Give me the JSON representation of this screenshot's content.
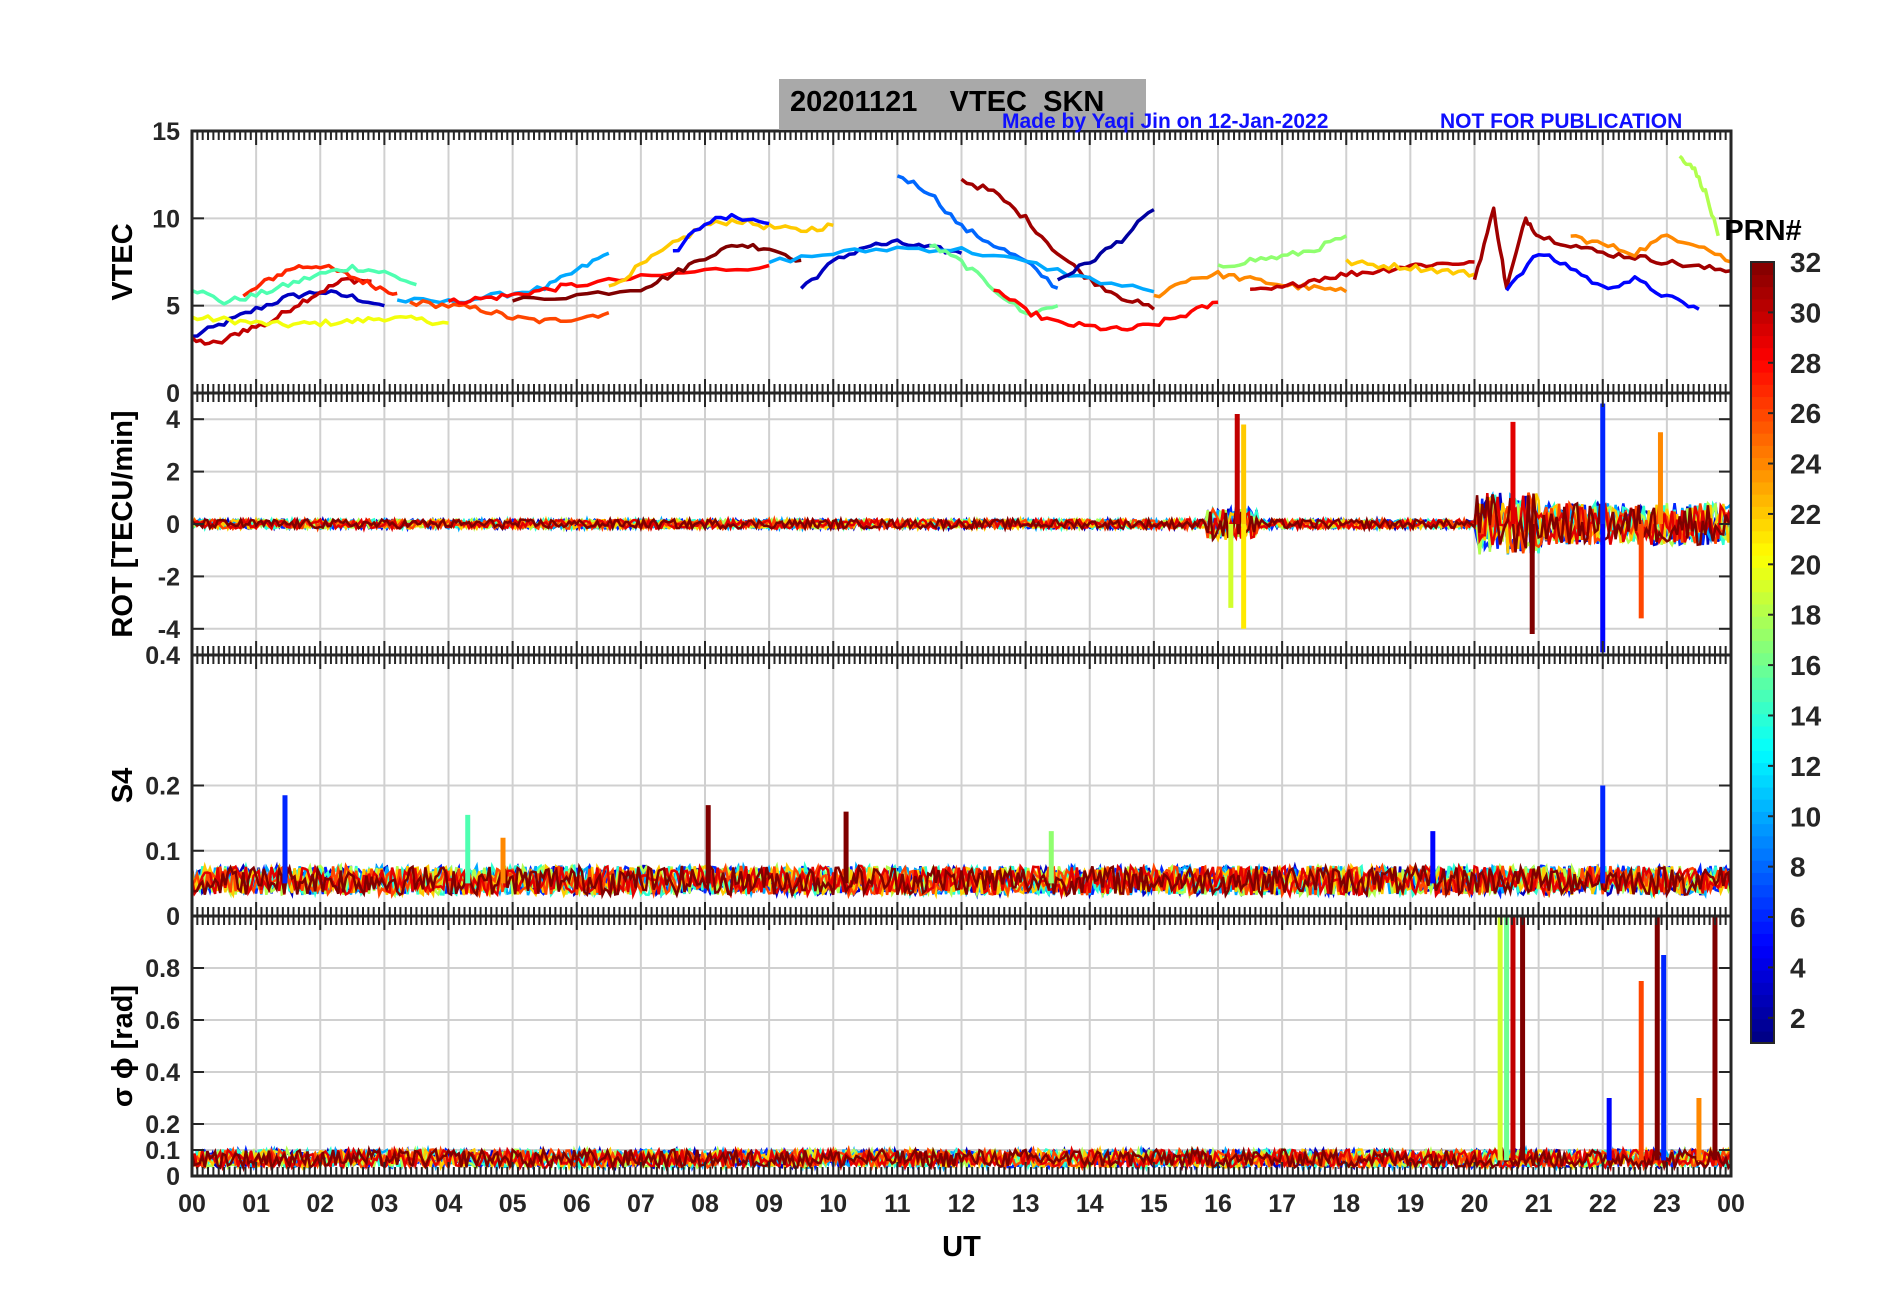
{
  "header": {
    "title": "20201121    VTEC  SKN",
    "credit": "Made by Yaqi Jin on 12-Jan-2022",
    "notice": "NOT FOR PUBLICATION"
  },
  "colorbar": {
    "title": "PRN#",
    "ticks": [
      "2",
      "4",
      "6",
      "8",
      "10",
      "12",
      "14",
      "16",
      "18",
      "20",
      "22",
      "24",
      "26",
      "28",
      "30",
      "32"
    ],
    "range": [
      1,
      32
    ],
    "colormap": "jet"
  },
  "chart_data": [
    {
      "type": "line",
      "panel": "VTEC",
      "ylabel": "VTEC",
      "ylim": [
        0,
        15
      ],
      "yticks": [
        "0",
        "5",
        "10",
        "15"
      ],
      "xlim": [
        0,
        24
      ],
      "grid": true,
      "series": [
        {
          "prn": 3,
          "x": [
            0,
            0.5,
            1.0,
            1.5,
            2.0,
            2.5,
            3.0
          ],
          "y": [
            3.2,
            4.0,
            4.8,
            5.5,
            5.8,
            5.5,
            5.0
          ]
        },
        {
          "prn": 30,
          "x": [
            0,
            0.4,
            0.8,
            1.2,
            1.6,
            2.0,
            2.4,
            2.8
          ],
          "y": [
            3.0,
            2.8,
            3.6,
            4.0,
            5.0,
            5.8,
            6.5,
            6.4
          ]
        },
        {
          "prn": 20,
          "x": [
            0,
            0.5,
            1.0,
            1.5,
            2.0,
            2.5,
            3.0,
            3.5,
            4.0
          ],
          "y": [
            4.3,
            4.2,
            4.0,
            3.9,
            4.0,
            4.1,
            4.3,
            4.2,
            4.0
          ]
        },
        {
          "prn": 27,
          "x": [
            0.8,
            1.2,
            1.6,
            2.0,
            2.4,
            2.8,
            3.2
          ],
          "y": [
            5.5,
            6.5,
            7.2,
            7.3,
            6.8,
            6.2,
            5.7
          ]
        },
        {
          "prn": 15,
          "x": [
            0,
            0.5,
            1.0,
            1.5,
            2.0,
            2.5,
            3.0,
            3.5
          ],
          "y": [
            6.0,
            5.2,
            5.6,
            6.2,
            6.8,
            7.2,
            6.9,
            6.2
          ]
        },
        {
          "prn": 10,
          "x": [
            3.2,
            4.0,
            4.8,
            5.5,
            6.0,
            6.5
          ],
          "y": [
            5.3,
            5.2,
            5.6,
            6.0,
            7.0,
            8.0
          ]
        },
        {
          "prn": 26,
          "x": [
            3.4,
            4.0,
            4.5,
            5.0,
            5.5,
            6.0,
            6.5
          ],
          "y": [
            5.2,
            5.0,
            4.8,
            4.3,
            4.1,
            4.3,
            4.6
          ]
        },
        {
          "prn": 28,
          "x": [
            4.0,
            4.5,
            5.0,
            5.5,
            6.0,
            7.0,
            8.0,
            9.0
          ],
          "y": [
            5.2,
            5.4,
            5.6,
            5.9,
            6.2,
            6.6,
            7.0,
            7.3
          ]
        },
        {
          "prn": 22,
          "x": [
            6.5,
            7.0,
            7.5,
            8.0,
            8.5,
            9.0,
            9.5,
            10.0
          ],
          "y": [
            6.0,
            7.3,
            8.5,
            9.6,
            9.9,
            9.5,
            9.3,
            9.6
          ]
        },
        {
          "prn": 32,
          "x": [
            5.0,
            6.0,
            7.0,
            7.5,
            8.0,
            8.5,
            9.0,
            9.5
          ],
          "y": [
            5.3,
            5.6,
            6.0,
            6.8,
            7.8,
            8.5,
            8.3,
            7.6
          ]
        },
        {
          "prn": 5,
          "x": [
            7.5,
            8.0,
            8.5,
            9.0
          ],
          "y": [
            8.0,
            9.8,
            10.1,
            9.7
          ]
        },
        {
          "prn": 3,
          "x": [
            9.5,
            10.0,
            10.5,
            11.0,
            11.5,
            12.0
          ],
          "y": [
            6.0,
            7.5,
            8.4,
            8.6,
            8.3,
            8.0
          ]
        },
        {
          "prn": 8,
          "x": [
            11.0,
            11.5,
            12.0,
            12.5,
            13.0,
            13.5
          ],
          "y": [
            12.5,
            11.5,
            9.5,
            8.5,
            7.5,
            6.0
          ]
        },
        {
          "prn": 31,
          "x": [
            12.0,
            12.5,
            13.0,
            13.5,
            14.0,
            14.5,
            15.0
          ],
          "y": [
            12.2,
            11.5,
            10.0,
            8.0,
            6.5,
            5.5,
            4.8
          ]
        },
        {
          "prn": 10,
          "x": [
            9.0,
            10.0,
            11.0,
            12.0,
            13.0,
            14.0,
            15.0
          ],
          "y": [
            7.5,
            8.0,
            8.3,
            8.2,
            7.5,
            6.5,
            5.8
          ]
        },
        {
          "prn": 16,
          "x": [
            11.5,
            12.0,
            12.5,
            13.0,
            13.5
          ],
          "y": [
            8.5,
            7.5,
            6.0,
            4.5,
            5.0
          ]
        },
        {
          "prn": 2,
          "x": [
            13.5,
            14.0,
            14.5,
            15.0
          ],
          "y": [
            6.5,
            7.5,
            8.8,
            10.5
          ]
        },
        {
          "prn": 28,
          "x": [
            12.5,
            13.0,
            13.5,
            14.0,
            14.5,
            15.0,
            15.5,
            16.0
          ],
          "y": [
            6.0,
            4.7,
            4.0,
            3.8,
            3.6,
            3.9,
            4.5,
            5.2
          ]
        },
        {
          "prn": 24,
          "x": [
            15.0,
            15.5,
            16.0,
            16.5,
            17.0,
            17.5,
            18.0
          ],
          "y": [
            5.5,
            6.5,
            6.8,
            6.5,
            6.2,
            6.0,
            5.8
          ]
        },
        {
          "prn": 17,
          "x": [
            16.0,
            16.5,
            17.0,
            17.5,
            18.0
          ],
          "y": [
            7.2,
            7.6,
            7.8,
            8.2,
            9.0
          ]
        },
        {
          "prn": 30,
          "x": [
            16.5,
            17.0,
            17.5,
            18.0,
            18.5,
            19.0,
            19.5,
            20.0
          ],
          "y": [
            5.8,
            6.0,
            6.5,
            6.8,
            7.0,
            7.3,
            7.4,
            7.5
          ]
        },
        {
          "prn": 22,
          "x": [
            18.0,
            18.5,
            19.0,
            19.5,
            20.0
          ],
          "y": [
            7.5,
            7.3,
            7.2,
            7.0,
            6.8
          ]
        },
        {
          "prn": 31,
          "x": [
            20.0,
            20.3,
            20.5,
            20.8,
            21.0,
            21.5,
            22.0,
            22.5,
            23.0,
            23.5,
            24.0
          ],
          "y": [
            6.5,
            10.5,
            6.0,
            10.0,
            9.0,
            8.5,
            8.0,
            7.8,
            7.5,
            7.2,
            7.0
          ]
        },
        {
          "prn": 5,
          "x": [
            20.5,
            21.0,
            21.5,
            22.0,
            22.5,
            23.0,
            23.5
          ],
          "y": [
            6.0,
            8.0,
            7.2,
            6.0,
            6.5,
            5.5,
            4.8
          ]
        },
        {
          "prn": 24,
          "x": [
            21.5,
            22.0,
            22.5,
            23.0,
            23.5,
            24.0
          ],
          "y": [
            9.0,
            8.5,
            8.0,
            9.0,
            8.5,
            7.5
          ]
        },
        {
          "prn": 18,
          "x": [
            23.2,
            23.4,
            23.6,
            23.8
          ],
          "y": [
            13.5,
            13.0,
            11.5,
            9.0
          ]
        }
      ]
    },
    {
      "type": "line",
      "panel": "ROT",
      "ylabel": "ROT [TECU/min]",
      "ylim": [
        -5,
        5
      ],
      "yticks": [
        "-4",
        "-2",
        "0",
        "2",
        "4"
      ],
      "xlim": [
        0,
        24
      ],
      "grid": true,
      "spikes": [
        {
          "prn": 30,
          "x": 16.3,
          "y": 4.2
        },
        {
          "prn": 22,
          "x": 16.4,
          "y": 3.8
        },
        {
          "prn": 19,
          "x": 16.2,
          "y": -3.2
        },
        {
          "prn": 21,
          "x": 16.4,
          "y": -4.0
        },
        {
          "prn": 29,
          "x": 20.6,
          "y": 3.9
        },
        {
          "prn": 32,
          "x": 20.9,
          "y": -4.2
        },
        {
          "prn": 6,
          "x": 22.0,
          "y": 4.6
        },
        {
          "prn": 5,
          "x": 22.0,
          "y": -4.9
        },
        {
          "prn": 26,
          "x": 22.6,
          "y": -3.6
        },
        {
          "prn": 24,
          "x": 22.9,
          "y": 3.5
        }
      ]
    },
    {
      "type": "line",
      "panel": "S4",
      "ylabel": "S4",
      "ylim": [
        0,
        0.4
      ],
      "yticks": [
        "0",
        "0.1",
        "0.2",
        "0.4"
      ],
      "xlim": [
        0,
        24
      ],
      "grid": true,
      "baseline": 0.05,
      "spikes": [
        {
          "prn": 6,
          "x": 1.45,
          "y": 0.185
        },
        {
          "prn": 15,
          "x": 4.3,
          "y": 0.155
        },
        {
          "prn": 24,
          "x": 4.85,
          "y": 0.12
        },
        {
          "prn": 32,
          "x": 8.05,
          "y": 0.17
        },
        {
          "prn": 32,
          "x": 10.2,
          "y": 0.16
        },
        {
          "prn": 17,
          "x": 13.4,
          "y": 0.13
        },
        {
          "prn": 5,
          "x": 19.35,
          "y": 0.13
        },
        {
          "prn": 6,
          "x": 22.0,
          "y": 0.2
        }
      ]
    },
    {
      "type": "line",
      "panel": "sigma_phi",
      "ylabel": "σ ϕ [rad]",
      "ylim": [
        0,
        1
      ],
      "yticks": [
        "0",
        "0.1",
        "0.2",
        "0.4",
        "0.6",
        "0.8"
      ],
      "xlim": [
        0,
        24
      ],
      "xlabel": "UT",
      "xticks": [
        "00",
        "01",
        "02",
        "03",
        "04",
        "05",
        "06",
        "07",
        "08",
        "09",
        "10",
        "11",
        "12",
        "13",
        "14",
        "15",
        "16",
        "17",
        "18",
        "19",
        "20",
        "21",
        "22",
        "23",
        "00"
      ],
      "grid": true,
      "baseline": 0.06,
      "spikes": [
        {
          "prn": 19,
          "x": 20.4,
          "y": 1.0
        },
        {
          "prn": 16,
          "x": 20.5,
          "y": 1.0
        },
        {
          "prn": 30,
          "x": 20.6,
          "y": 1.0
        },
        {
          "prn": 32,
          "x": 20.75,
          "y": 1.0
        },
        {
          "prn": 26,
          "x": 22.6,
          "y": 0.75
        },
        {
          "prn": 32,
          "x": 22.85,
          "y": 1.0
        },
        {
          "prn": 6,
          "x": 22.95,
          "y": 0.85
        },
        {
          "prn": 32,
          "x": 23.75,
          "y": 1.0
        },
        {
          "prn": 24,
          "x": 23.5,
          "y": 0.3
        },
        {
          "prn": 5,
          "x": 22.1,
          "y": 0.3
        }
      ]
    }
  ]
}
